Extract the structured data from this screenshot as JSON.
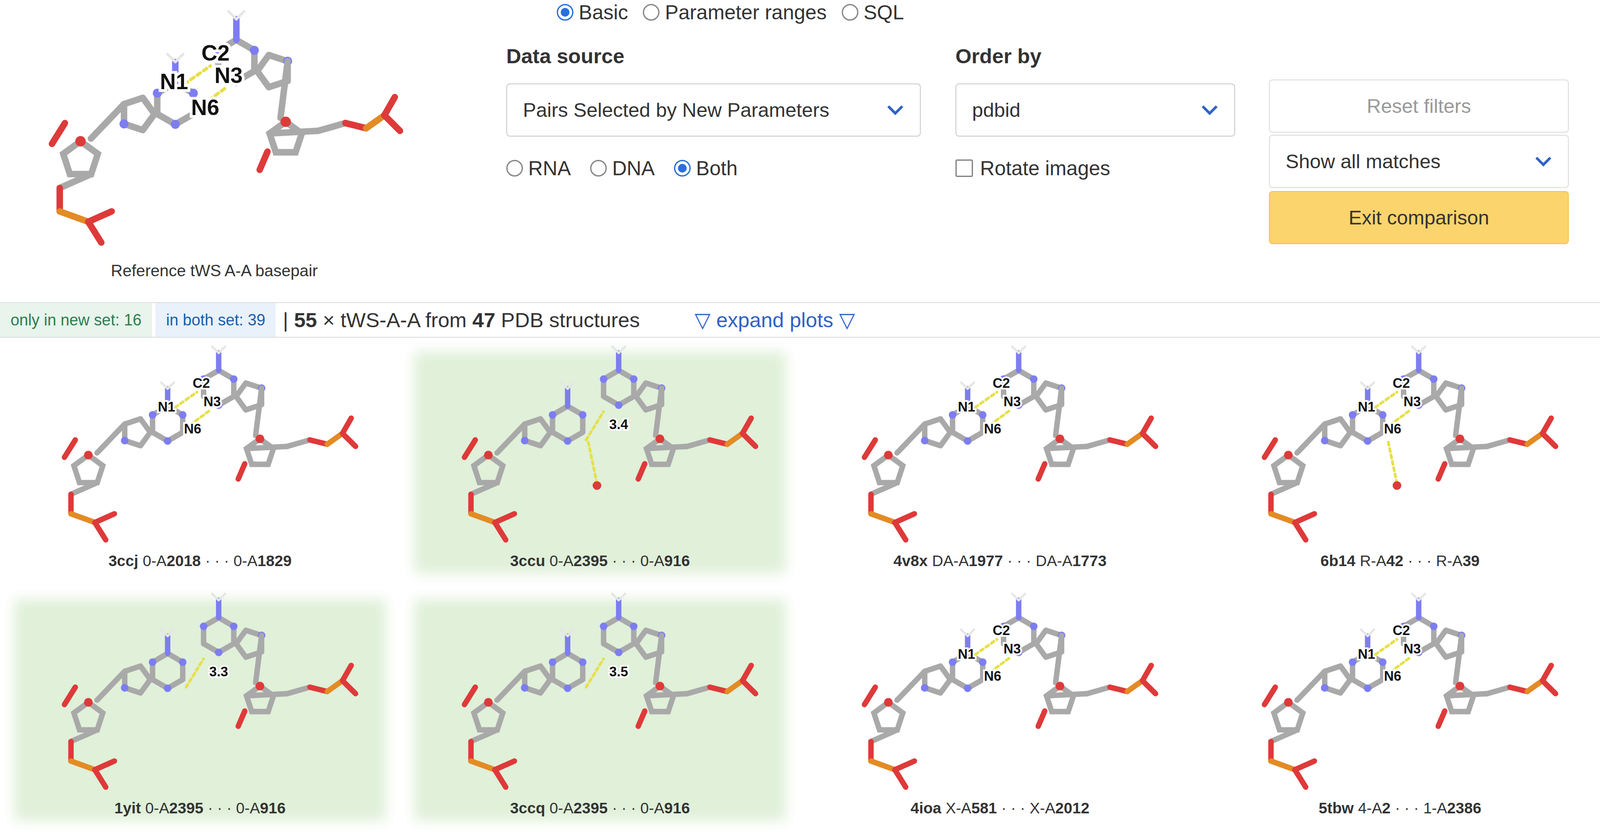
{
  "mode_options": [
    {
      "label": "Basic",
      "selected": true
    },
    {
      "label": "Parameter ranges",
      "selected": false
    },
    {
      "label": "SQL",
      "selected": false
    }
  ],
  "reference": {
    "caption": "Reference tWS A-A basepair",
    "labels": [
      "N1",
      "C2",
      "N3",
      "N6"
    ]
  },
  "data_source": {
    "label": "Data source",
    "value": "Pairs Selected by New Parameters"
  },
  "molecule_type": [
    {
      "label": "RNA",
      "selected": false
    },
    {
      "label": "DNA",
      "selected": false
    },
    {
      "label": "Both",
      "selected": true
    }
  ],
  "order_by": {
    "label": "Order by",
    "value": "pdbid"
  },
  "rotate_images": {
    "label": "Rotate images",
    "checked": false
  },
  "reset_filters": {
    "label": "Reset filters",
    "disabled": true
  },
  "match_filter": {
    "value": "Show all matches"
  },
  "exit_comparison": {
    "label": "Exit comparison"
  },
  "summary": {
    "only_new": "only in new set: 16",
    "both": "in both set: 39",
    "separator": "| ",
    "count": "55",
    "count_text": " × tWS-A-A from ",
    "structures": "47",
    "structures_text": " PDB structures",
    "expand": "▽ expand plots ▽"
  },
  "cards": [
    {
      "pdbid": "3ccj",
      "chain1": "0-A",
      "num1": "2018",
      "sep": "· · ·",
      "chain2": "0-A",
      "num2": "1829",
      "kind": "atoms",
      "labels": [
        "N1",
        "C2",
        "N3",
        "N6"
      ],
      "only_in_new": false,
      "water": false
    },
    {
      "pdbid": "3ccu",
      "chain1": "0-A",
      "num1": "2395",
      "sep": "· · ·",
      "chain2": "0-A",
      "num2": "916",
      "kind": "distance",
      "distance": "3.4",
      "only_in_new": true,
      "water": true
    },
    {
      "pdbid": "4v8x",
      "chain1": "DA-A",
      "num1": "1977",
      "sep": "· · ·",
      "chain2": "DA-A",
      "num2": "1773",
      "kind": "atoms",
      "labels": [
        "N1",
        "C2",
        "N3",
        "N6"
      ],
      "only_in_new": false,
      "water": false
    },
    {
      "pdbid": "6b14",
      "chain1": "R-A",
      "num1": "42",
      "sep": "· · ·",
      "chain2": "R-A",
      "num2": "39",
      "kind": "atoms",
      "labels": [
        "N1",
        "C2",
        "N3",
        "N6"
      ],
      "only_in_new": false,
      "water": true
    },
    {
      "pdbid": "1yit",
      "chain1": "0-A",
      "num1": "2395",
      "sep": "· · ·",
      "chain2": "0-A",
      "num2": "916",
      "kind": "distance",
      "distance": "3.3",
      "only_in_new": true,
      "water": false
    },
    {
      "pdbid": "3ccq",
      "chain1": "0-A",
      "num1": "2395",
      "sep": "· · ·",
      "chain2": "0-A",
      "num2": "916",
      "kind": "distance",
      "distance": "3.5",
      "only_in_new": true,
      "water": false
    },
    {
      "pdbid": "4ioa",
      "chain1": "X-A",
      "num1": "581",
      "sep": "· · ·",
      "chain2": "X-A",
      "num2": "2012",
      "kind": "atoms",
      "labels": [
        "N1",
        "C2",
        "N3",
        "N6"
      ],
      "only_in_new": false,
      "water": false
    },
    {
      "pdbid": "5tbw",
      "chain1": "4-A",
      "num1": "2",
      "sep": "· · ·",
      "chain2": "1-A",
      "num2": "2386",
      "kind": "atoms",
      "labels": [
        "N1",
        "C2",
        "N3",
        "N6"
      ],
      "only_in_new": false,
      "water": false
    }
  ]
}
